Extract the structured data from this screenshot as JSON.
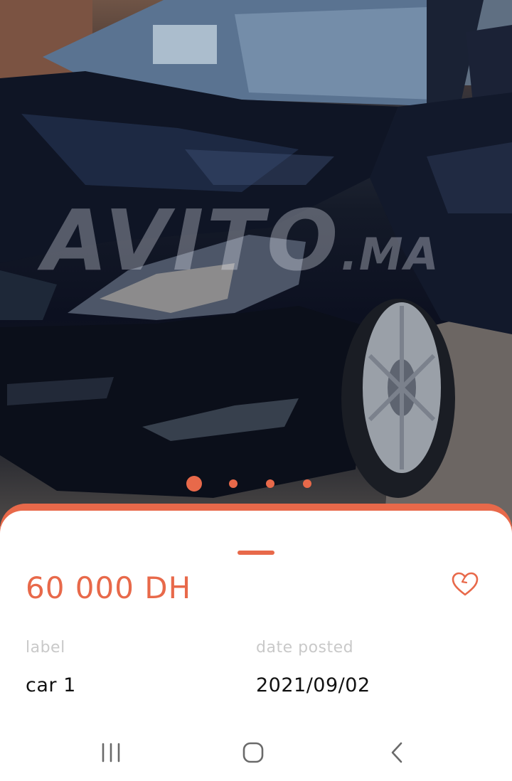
{
  "photo": {
    "watermark_main": "AVITO",
    "watermark_suffix": ".MA",
    "carousel_dots": 4,
    "active_index": 0
  },
  "listing": {
    "price": "60 000 DH",
    "label_caption": "label",
    "label_value": "car 1",
    "date_caption": "date posted",
    "date_value": "2021/09/02"
  },
  "colors": {
    "accent": "#e8694a",
    "caption": "#c9c9c9",
    "value": "#111111"
  },
  "icons": {
    "favorite": "heart-outline-icon",
    "nav_recents": "recents-icon",
    "nav_home": "home-icon",
    "nav_back": "back-icon"
  }
}
